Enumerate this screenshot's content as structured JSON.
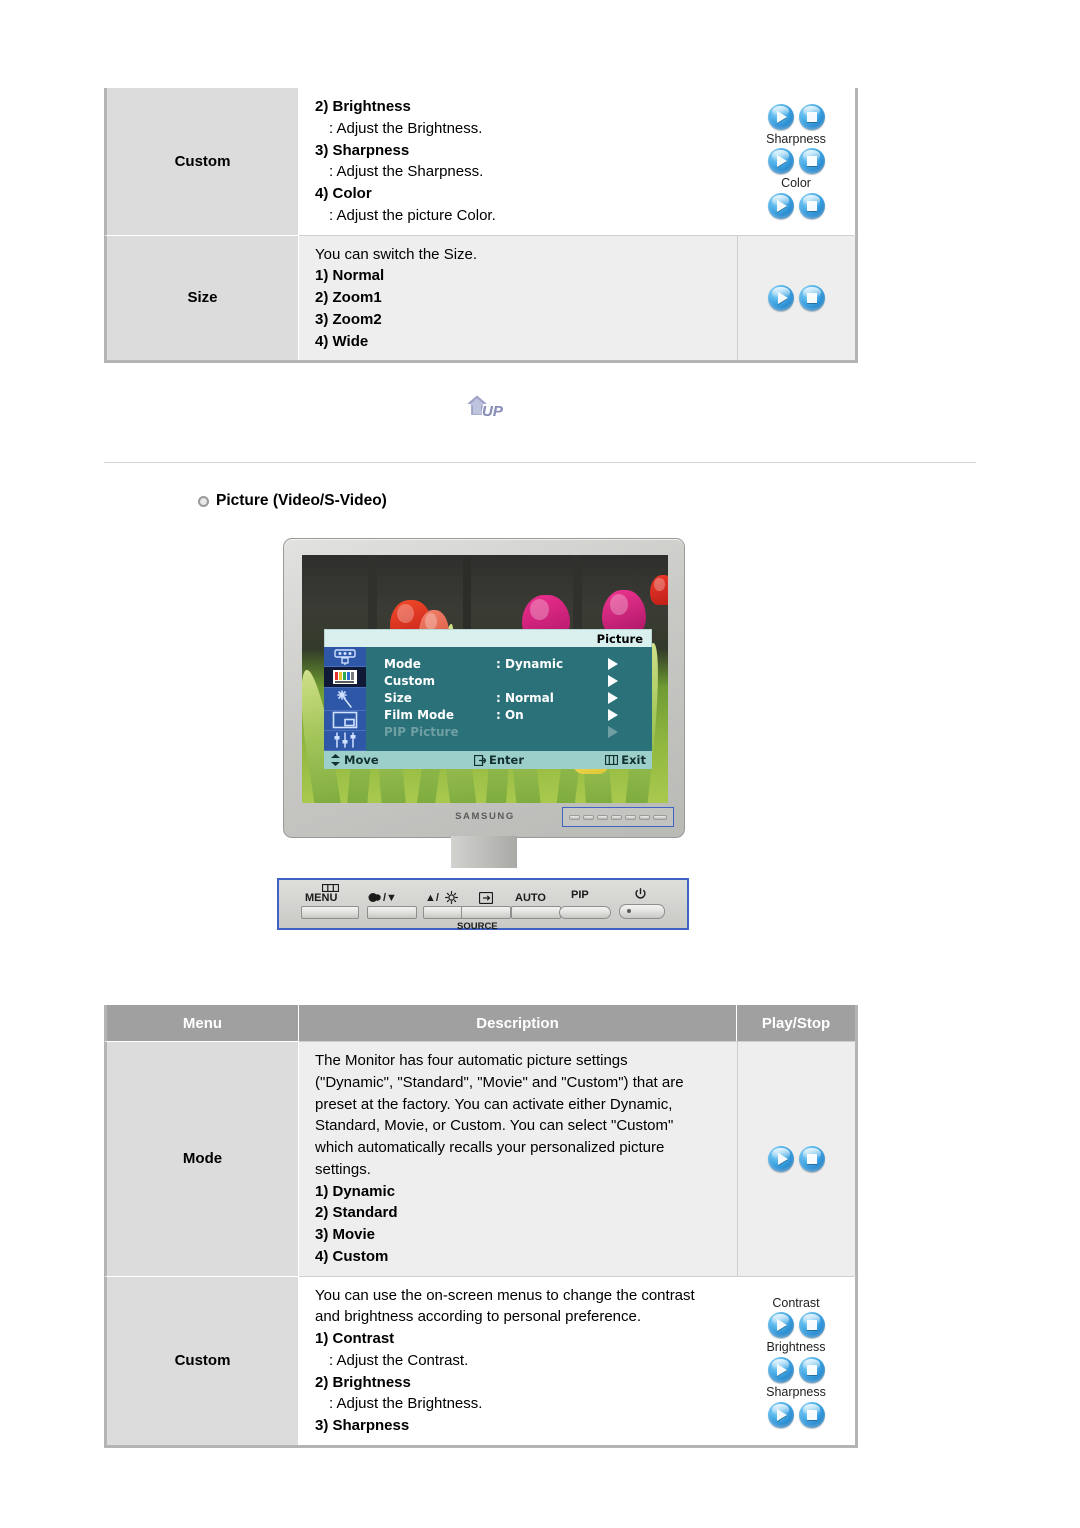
{
  "top_table": {
    "rows": [
      {
        "menu": "Custom",
        "shaded": false,
        "desc_lines": [
          {
            "type": "num",
            "text": "2) Brightness"
          },
          {
            "type": "sub",
            "text": ": Adjust the Brightness."
          },
          {
            "type": "num",
            "text": "3) Sharpness"
          },
          {
            "type": "sub",
            "text": ": Adjust the Sharpness."
          },
          {
            "type": "num",
            "text": "4) Color"
          },
          {
            "type": "sub",
            "text": ": Adjust the picture Color."
          }
        ],
        "play": {
          "groups": [
            {
              "label": "",
              "buttons": [
                "play-icon",
                "stop-icon"
              ]
            },
            {
              "label": "Sharpness",
              "buttons": [
                "play-icon",
                "stop-icon"
              ]
            },
            {
              "label": "Color",
              "buttons": [
                "play-icon",
                "stop-icon"
              ]
            }
          ],
          "divided": false
        }
      },
      {
        "menu": "Size",
        "shaded": true,
        "desc_lines": [
          {
            "type": "plain",
            "text": "You can switch the Size."
          },
          {
            "type": "num",
            "text": "1) Normal"
          },
          {
            "type": "num",
            "text": "2) Zoom1"
          },
          {
            "type": "num",
            "text": "3) Zoom2"
          },
          {
            "type": "num",
            "text": "4) Wide"
          }
        ],
        "play": {
          "groups": [
            {
              "label": "",
              "buttons": [
                "play-icon",
                "stop-icon"
              ]
            }
          ],
          "divided": true
        }
      }
    ]
  },
  "up_button": {
    "label": "UP"
  },
  "section": {
    "heading": "Picture (Video/S-Video)"
  },
  "monitor": {
    "brand": "SAMSUNG",
    "osd": {
      "title": "Picture",
      "sidebar_icons": [
        "input-source-icon",
        "picture-icon",
        "sound-icon",
        "pip-icon",
        "setup-icon"
      ],
      "selected_sidebar_index": 1,
      "items": [
        {
          "label": "Mode",
          "value": ": Dynamic",
          "dim": false
        },
        {
          "label": "Custom",
          "value": "",
          "dim": false
        },
        {
          "label": "Size",
          "value": ": Normal",
          "dim": false
        },
        {
          "label": "Film Mode",
          "value": ": On",
          "dim": false
        },
        {
          "label": "PIP Picture",
          "value": "",
          "dim": true
        }
      ],
      "footer": {
        "move": "Move",
        "enter": "Enter",
        "exit": "Exit"
      }
    },
    "control_panel": {
      "keys": [
        {
          "name": "menu-button",
          "label": "MENU",
          "icon": "menu-bars-icon"
        },
        {
          "name": "down-button",
          "label": "/▼",
          "icon": "contrast-icon"
        },
        {
          "name": "up-button",
          "label": "▲/",
          "icon": "brightness-icon"
        },
        {
          "name": "enter-source-button",
          "label": "",
          "icon": "enter-icon"
        },
        {
          "name": "auto-button",
          "label": "AUTO",
          "icon": ""
        },
        {
          "name": "pip-button",
          "label": "PIP",
          "icon": ""
        },
        {
          "name": "power-button",
          "label": "",
          "icon": "power-icon"
        }
      ],
      "source_label": "SOURCE"
    }
  },
  "bottom_table": {
    "headers": [
      "Menu",
      "Description",
      "Play/Stop"
    ],
    "rows": [
      {
        "menu": "Mode",
        "shaded": true,
        "desc_lines": [
          {
            "type": "plain",
            "text": "The Monitor has four automatic picture settings"
          },
          {
            "type": "plain",
            "text": "(\"Dynamic\", \"Standard\", \"Movie\" and \"Custom\") that are"
          },
          {
            "type": "plain",
            "text": "preset at the factory. You can activate either Dynamic,"
          },
          {
            "type": "plain",
            "text": "Standard, Movie, or Custom. You can select \"Custom\""
          },
          {
            "type": "plain",
            "text": "which automatically recalls your personalized picture"
          },
          {
            "type": "plain",
            "text": "settings."
          },
          {
            "type": "num",
            "text": "1) Dynamic"
          },
          {
            "type": "num",
            "text": "2) Standard"
          },
          {
            "type": "num",
            "text": "3) Movie"
          },
          {
            "type": "num",
            "text": "4) Custom"
          }
        ],
        "play": {
          "groups": [
            {
              "label": "",
              "buttons": [
                "play-icon",
                "stop-icon"
              ]
            }
          ],
          "divided": true
        }
      },
      {
        "menu": "Custom",
        "shaded": false,
        "desc_lines": [
          {
            "type": "plain",
            "text": "You can use the on-screen menus to change the contrast"
          },
          {
            "type": "plain",
            "text": "and brightness according to personal preference."
          },
          {
            "type": "num",
            "text": "1) Contrast"
          },
          {
            "type": "sub",
            "text": ": Adjust the Contrast."
          },
          {
            "type": "num",
            "text": "2) Brightness"
          },
          {
            "type": "sub",
            "text": ": Adjust the Brightness."
          },
          {
            "type": "num",
            "text": "3) Sharpness"
          }
        ],
        "play": {
          "groups": [
            {
              "label": "Contrast",
              "buttons": [
                "play-icon",
                "stop-icon"
              ]
            },
            {
              "label": "Brightness",
              "buttons": [
                "play-icon",
                "stop-icon"
              ]
            },
            {
              "label": "Sharpness",
              "buttons": [
                "play-icon",
                "stop-icon"
              ]
            }
          ],
          "divided": false
        }
      }
    ]
  },
  "colors": {
    "menu_cell_bg": "#dcdcdc",
    "shaded_bg": "#eeeeee",
    "header_bg": "#a0a0a0",
    "border": "#b4b4b4",
    "osd_body": "#2b7179",
    "osd_sidebar": "#2f57a8",
    "osd_title_bg": "#d9f0ee",
    "osd_footer_bg": "#9ccfc9",
    "callout_border": "#3f63c4",
    "button_blue": "#2a8fd4"
  }
}
